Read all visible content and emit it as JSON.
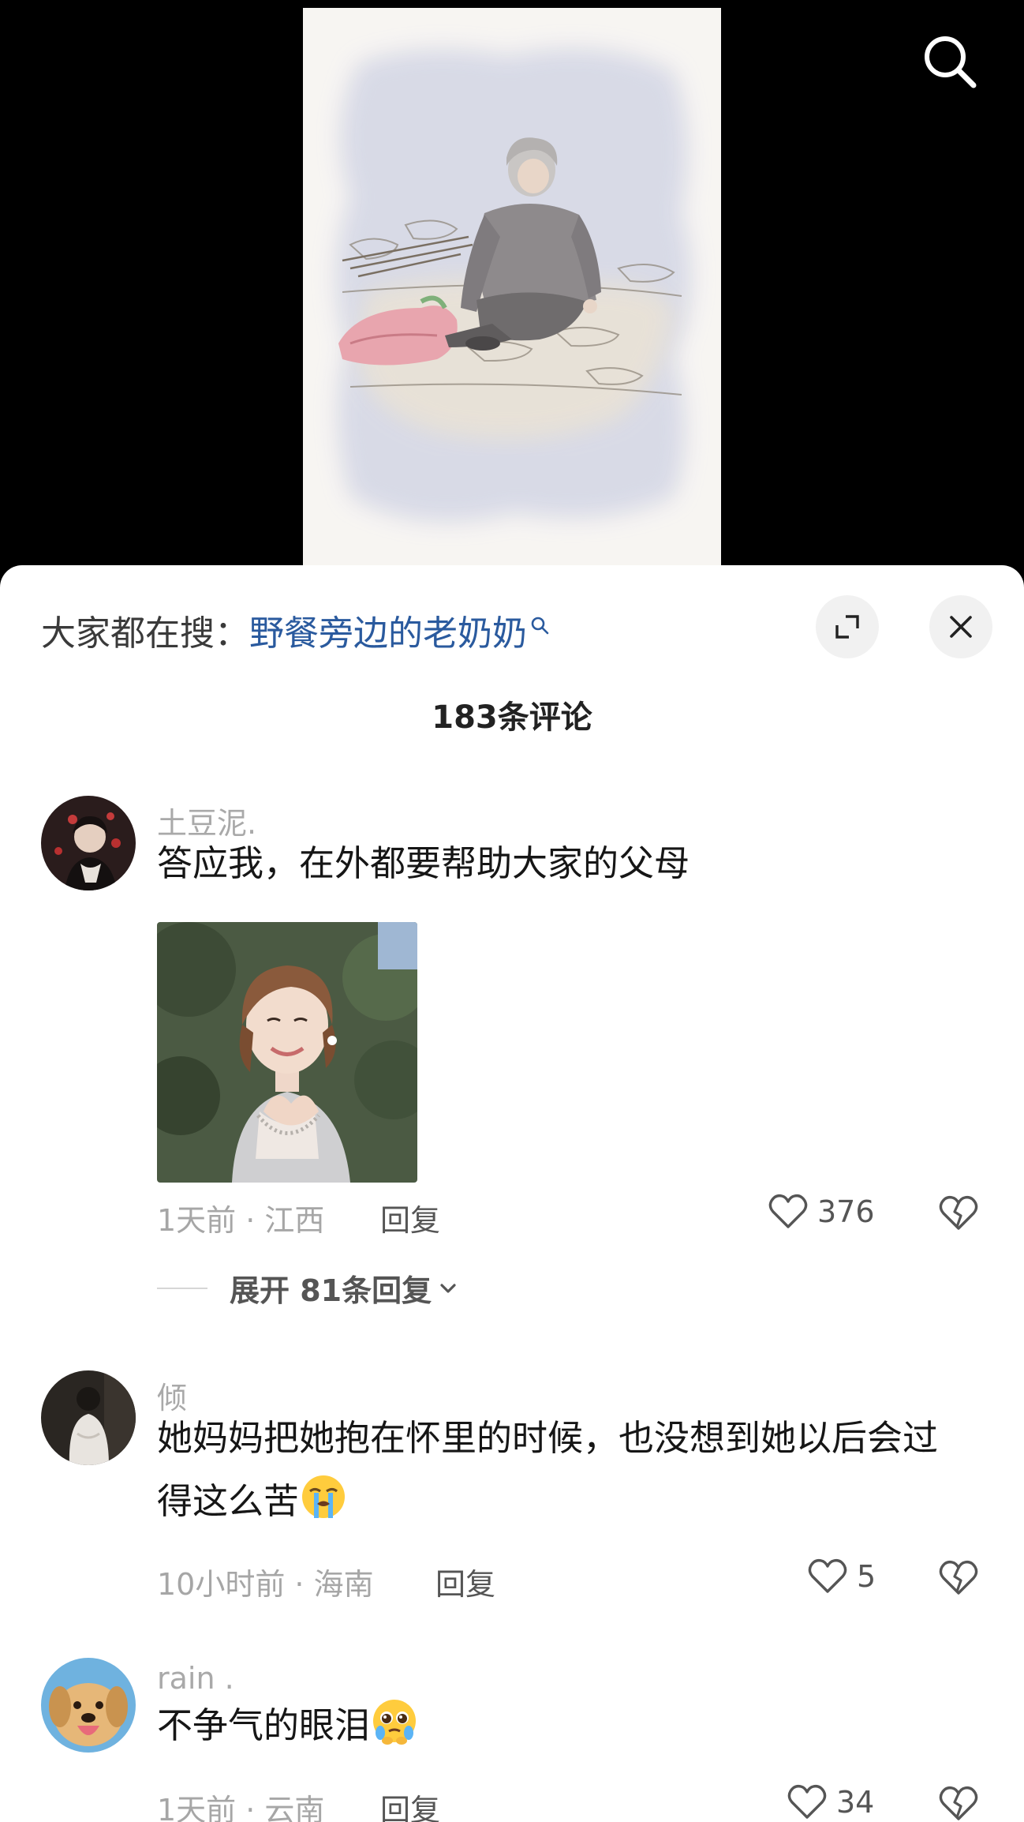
{
  "trending": {
    "prefix": "大家都在搜：",
    "keyword": "野餐旁边的老奶奶"
  },
  "comment_count_title": "183条评论",
  "comments": [
    {
      "username": "土豆泥.",
      "text": "答应我，在外都要帮助大家的父母",
      "meta": "1天前 · 江西",
      "reply_label": "回复",
      "likes": "376",
      "expand_label": "展开 81条回复"
    },
    {
      "username": "倾",
      "text": "她妈妈把她抱在怀里的时候，也没想到她以后会过得这么苦",
      "emoji": "loudly-crying-face",
      "meta": "10小时前 · 海南",
      "reply_label": "回复",
      "likes": "5"
    },
    {
      "username": "rain .",
      "text": "不争气的眼泪",
      "emoji": "pleading-face",
      "meta": "1天前 · 云南",
      "reply_label": "回复",
      "likes": "34"
    }
  ],
  "colors": {
    "keyword_link": "#2a5a9e",
    "sheet_background": "#ffffff",
    "video_background": "#000000"
  }
}
